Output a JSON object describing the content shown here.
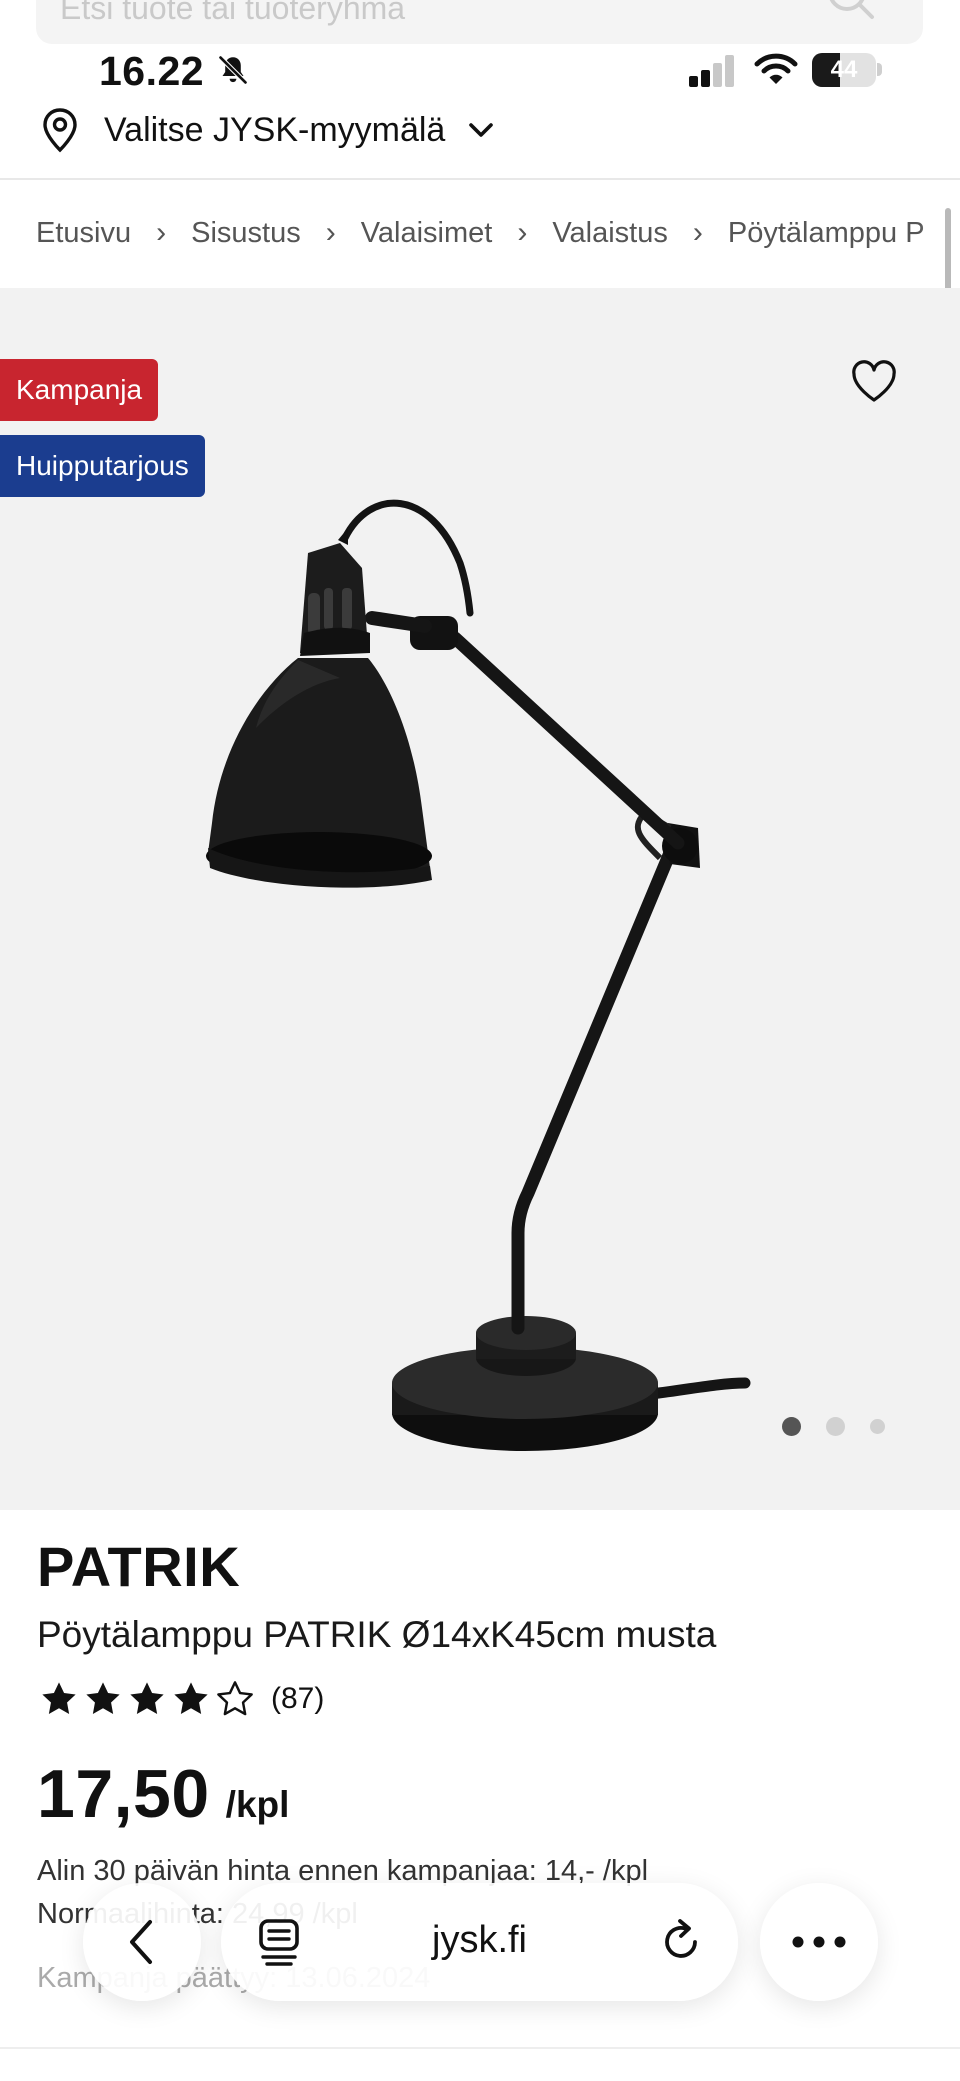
{
  "status_bar": {
    "time": "16.22",
    "battery": "44",
    "battery_level": 0.44
  },
  "search": {
    "placeholder": "Etsi tuote tai tuoteryhmä"
  },
  "store": {
    "label": "Valitse JYSK-myymälä"
  },
  "breadcrumbs": [
    "Etusivu",
    "Sisustus",
    "Valaisimet",
    "Valaistus",
    "Pöytälamppu P"
  ],
  "gallery": {
    "badges": [
      "Kampanja",
      "Huipputarjous"
    ],
    "image_alt": "Musta pöytälamppu PATRIK",
    "dots_total": 3,
    "active_dot": 0
  },
  "product": {
    "brand": "PATRIK",
    "title": "Pöytälamppu PATRIK Ø14xK45cm musta",
    "rating": 4,
    "rating_max": 5,
    "review_count": "(87)",
    "price": "17,50",
    "unit": "/kpl",
    "lowest_price_note": "Alin 30 päivän hinta ennen kampanjaa: 14,- /kpl",
    "normal_price_note": "Normaalihinta: 24,99 /kpl",
    "campaign_end_note": "Kampanja päättyy: 13.06.2024"
  },
  "browser": {
    "host": "jysk.fi"
  },
  "colors": {
    "campaign_badge": "#c8252f",
    "top_deal_badge": "#1b3d8f",
    "gallery_bg": "#f2f2f2"
  }
}
